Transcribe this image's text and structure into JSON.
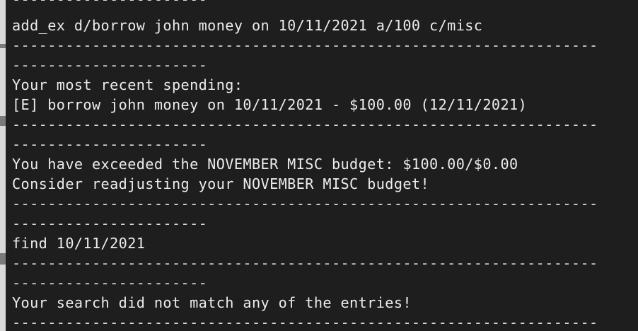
{
  "terminal": {
    "lines": [
      "----------------------",
      "add_ex d/borrow john money on 10/11/2021 a/100 c/misc",
      "------------------------------------------------------------------",
      "----------------------",
      "Your most recent spending:",
      "[E] borrow john money on 10/11/2021 - $100.00 (12/11/2021)",
      "------------------------------------------------------------------",
      "----------------------",
      "You have exceeded the NOVEMBER MISC budget: $100.00/$0.00",
      "Consider readjusting your NOVEMBER MISC budget!",
      "------------------------------------------------------------------",
      "----------------------",
      "find 10/11/2021",
      "------------------------------------------------------------------",
      "----------------------",
      "Your search did not match any of the entries!",
      "------------------------------------------------------------------"
    ]
  }
}
